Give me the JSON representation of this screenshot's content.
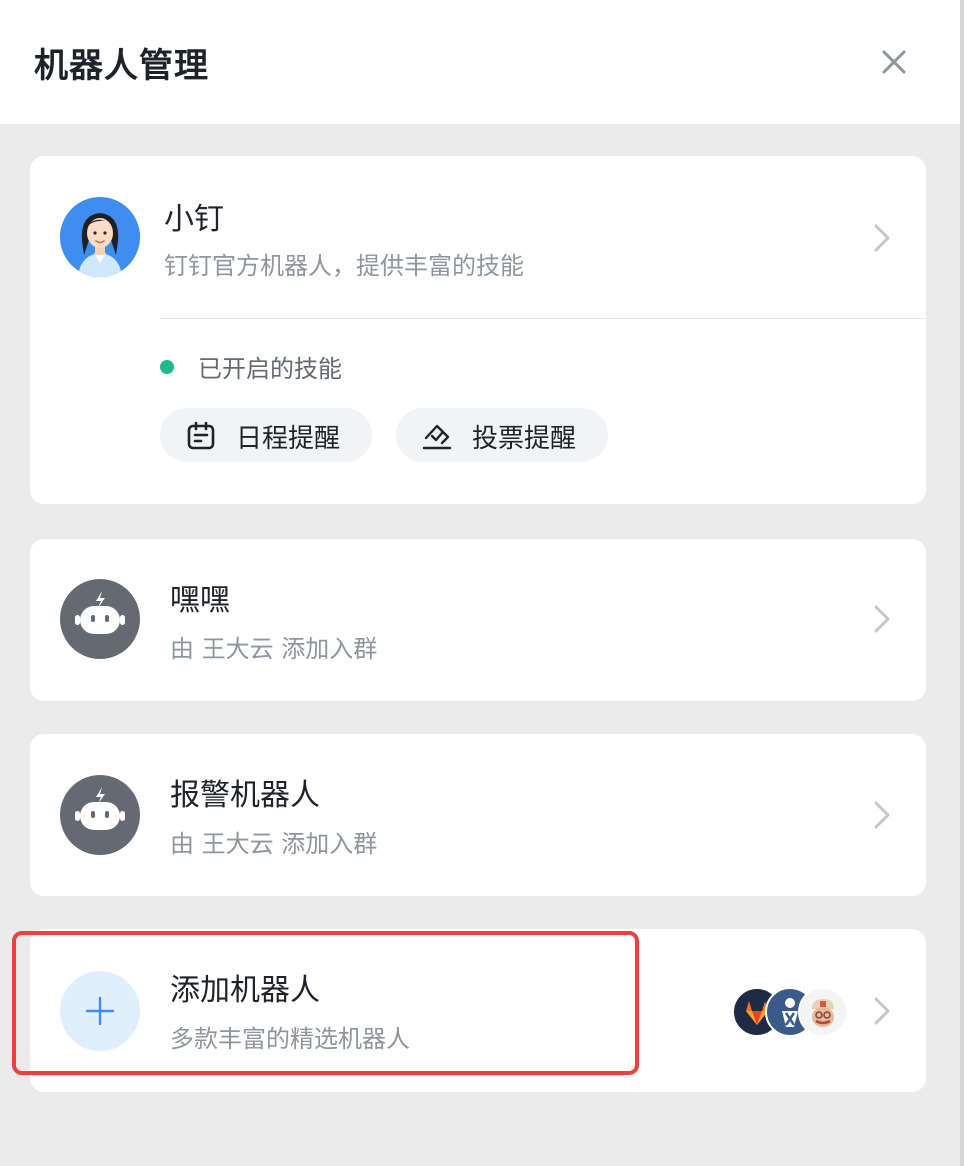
{
  "header": {
    "title": "机器人管理"
  },
  "primary_bot": {
    "name": "小钉",
    "description": "钉钉官方机器人，提供丰富的技能",
    "skills_label": "已开启的技能",
    "skills": [
      {
        "label": "日程提醒",
        "icon": "calendar-icon"
      },
      {
        "label": "投票提醒",
        "icon": "vote-icon"
      }
    ]
  },
  "bots": [
    {
      "name": "嘿嘿",
      "added_by": "由 王大云 添加入群",
      "icon": "robot-icon"
    },
    {
      "name": "报警机器人",
      "added_by": "由 王大云 添加入群",
      "icon": "robot-icon"
    }
  ],
  "add_bot": {
    "title": "添加机器人",
    "subtitle": "多款丰富的精选机器人",
    "icon": "plus-icon",
    "integration_icons": [
      "gitlab-icon",
      "jenkins-icon",
      "travis-icon"
    ]
  },
  "colors": {
    "accent": "#3370ff",
    "status_green": "#1fb98b",
    "highlight_red": "#e8433d",
    "bot_gray": "#646a73"
  }
}
